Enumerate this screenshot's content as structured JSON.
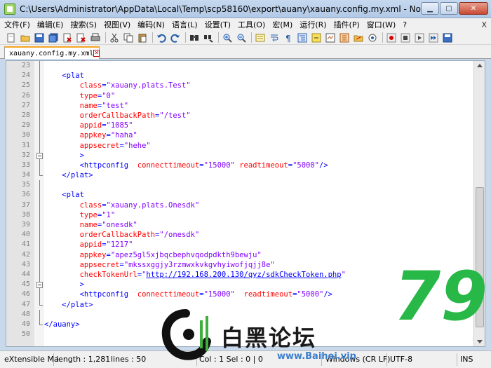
{
  "window": {
    "title": "C:\\Users\\Administrator\\AppData\\Local\\Temp\\scp58160\\export\\auany\\xauany.config.my.xml - Notepad++ [Administrat..."
  },
  "menu": [
    "文件(F)",
    "编辑(E)",
    "搜索(S)",
    "视图(V)",
    "编码(N)",
    "语言(L)",
    "设置(T)",
    "工具(O)",
    "宏(M)",
    "运行(R)",
    "插件(P)",
    "窗口(W)",
    "?"
  ],
  "menu_close": "X",
  "tab": {
    "label": "xauany.config.my.xml"
  },
  "editor": {
    "lines": [
      {
        "n": "23",
        "fold": "line",
        "parts": []
      },
      {
        "n": "24",
        "fold": "line",
        "parts": [
          [
            "sp",
            "    "
          ],
          [
            "tag",
            "<plat"
          ]
        ]
      },
      {
        "n": "25",
        "fold": "line",
        "parts": [
          [
            "sp",
            "        "
          ],
          [
            "attr",
            "class"
          ],
          [
            "tag",
            "="
          ],
          [
            "val",
            "\"xauany.plats.Test\""
          ]
        ]
      },
      {
        "n": "26",
        "fold": "line",
        "parts": [
          [
            "sp",
            "        "
          ],
          [
            "attr",
            "type"
          ],
          [
            "tag",
            "="
          ],
          [
            "val",
            "\"0\""
          ]
        ]
      },
      {
        "n": "27",
        "fold": "line",
        "parts": [
          [
            "sp",
            "        "
          ],
          [
            "attr",
            "name"
          ],
          [
            "tag",
            "="
          ],
          [
            "val",
            "\"test\""
          ]
        ]
      },
      {
        "n": "28",
        "fold": "line",
        "parts": [
          [
            "sp",
            "        "
          ],
          [
            "attr",
            "orderCallbackPath"
          ],
          [
            "tag",
            "="
          ],
          [
            "val",
            "\"/test\""
          ]
        ]
      },
      {
        "n": "29",
        "fold": "line",
        "parts": [
          [
            "sp",
            "        "
          ],
          [
            "attr",
            "appid"
          ],
          [
            "tag",
            "="
          ],
          [
            "val",
            "\"1085\""
          ]
        ]
      },
      {
        "n": "30",
        "fold": "line",
        "parts": [
          [
            "sp",
            "        "
          ],
          [
            "attr",
            "appkey"
          ],
          [
            "tag",
            "="
          ],
          [
            "val",
            "\"haha\""
          ]
        ]
      },
      {
        "n": "31",
        "fold": "line",
        "parts": [
          [
            "sp",
            "        "
          ],
          [
            "attr",
            "appsecret"
          ],
          [
            "tag",
            "="
          ],
          [
            "val",
            "\"hehe\""
          ]
        ]
      },
      {
        "n": "32",
        "fold": "box",
        "parts": [
          [
            "sp",
            "        "
          ],
          [
            "tag",
            ">"
          ]
        ]
      },
      {
        "n": "33",
        "fold": "line",
        "parts": [
          [
            "sp",
            "        "
          ],
          [
            "tag",
            "<httpconfig  "
          ],
          [
            "attr",
            "connecttimeout"
          ],
          [
            "tag",
            "="
          ],
          [
            "val",
            "\"15000\""
          ],
          [
            "sp",
            " "
          ],
          [
            "attr",
            "readtimeout"
          ],
          [
            "tag",
            "="
          ],
          [
            "val",
            "\"5000\""
          ],
          [
            "tag",
            "/>"
          ]
        ]
      },
      {
        "n": "34",
        "fold": "end",
        "parts": [
          [
            "sp",
            "    "
          ],
          [
            "tag",
            "</plat>"
          ]
        ]
      },
      {
        "n": "35",
        "fold": "line",
        "parts": []
      },
      {
        "n": "36",
        "fold": "line",
        "parts": [
          [
            "sp",
            "    "
          ],
          [
            "tag",
            "<plat"
          ]
        ]
      },
      {
        "n": "37",
        "fold": "line",
        "parts": [
          [
            "sp",
            "        "
          ],
          [
            "attr",
            "class"
          ],
          [
            "tag",
            "="
          ],
          [
            "val",
            "\"xauany.plats.Onesdk\""
          ]
        ]
      },
      {
        "n": "38",
        "fold": "line",
        "parts": [
          [
            "sp",
            "        "
          ],
          [
            "attr",
            "type"
          ],
          [
            "tag",
            "="
          ],
          [
            "val",
            "\"1\""
          ]
        ]
      },
      {
        "n": "39",
        "fold": "line",
        "parts": [
          [
            "sp",
            "        "
          ],
          [
            "attr",
            "name"
          ],
          [
            "tag",
            "="
          ],
          [
            "val",
            "\"onesdk\""
          ]
        ]
      },
      {
        "n": "40",
        "fold": "line",
        "parts": [
          [
            "sp",
            "        "
          ],
          [
            "attr",
            "orderCallbackPath"
          ],
          [
            "tag",
            "="
          ],
          [
            "val",
            "\"/onesdk\""
          ]
        ]
      },
      {
        "n": "41",
        "fold": "line",
        "parts": [
          [
            "sp",
            "        "
          ],
          [
            "attr",
            "appid"
          ],
          [
            "tag",
            "="
          ],
          [
            "val",
            "\"1217\""
          ]
        ]
      },
      {
        "n": "42",
        "fold": "line",
        "parts": [
          [
            "sp",
            "        "
          ],
          [
            "attr",
            "appkey"
          ],
          [
            "tag",
            "="
          ],
          [
            "val",
            "\"apez5gl5xjbqcbephvqodpdkth9bewju\""
          ]
        ]
      },
      {
        "n": "43",
        "fold": "line",
        "parts": [
          [
            "sp",
            "        "
          ],
          [
            "attr",
            "appsecret"
          ],
          [
            "tag",
            "="
          ],
          [
            "val",
            "\"mkssxggjy3rzmwxkvkgvhyiwofjqjj8e\""
          ]
        ]
      },
      {
        "n": "44",
        "fold": "line",
        "parts": [
          [
            "sp",
            "        "
          ],
          [
            "attr",
            "checkTokenUrl"
          ],
          [
            "tag",
            "="
          ],
          [
            "val",
            "\""
          ],
          [
            "link",
            "http://192.168.200.130/qyz/sdkCheckToken.php"
          ],
          [
            "val",
            "\""
          ]
        ]
      },
      {
        "n": "45",
        "fold": "box",
        "parts": [
          [
            "sp",
            "        "
          ],
          [
            "tag",
            ">"
          ]
        ]
      },
      {
        "n": "46",
        "fold": "line",
        "parts": [
          [
            "sp",
            "        "
          ],
          [
            "tag",
            "<httpconfig  "
          ],
          [
            "attr",
            "connecttimeout"
          ],
          [
            "tag",
            "="
          ],
          [
            "val",
            "\"15000\""
          ],
          [
            "sp",
            "  "
          ],
          [
            "attr",
            "readtimeout"
          ],
          [
            "tag",
            "="
          ],
          [
            "val",
            "\"5000\""
          ],
          [
            "tag",
            "/>"
          ]
        ]
      },
      {
        "n": "47",
        "fold": "end",
        "parts": [
          [
            "sp",
            "    "
          ],
          [
            "tag",
            "</plat>"
          ]
        ]
      },
      {
        "n": "48",
        "fold": "line",
        "parts": []
      },
      {
        "n": "49",
        "fold": "end",
        "parts": [
          [
            "tag",
            "</auany>"
          ]
        ]
      },
      {
        "n": "50",
        "fold": "none",
        "parts": []
      }
    ]
  },
  "status": {
    "filetype": "eXtensible Ma",
    "length": "length : 1,281",
    "lines": "lines : 50",
    "position": "Col : 1   Sel : 0 | 0",
    "eol": "Windows (CR LF)",
    "encoding": "UTF-8",
    "mode": "INS"
  },
  "watermark": {
    "text": "白黑论坛",
    "url": "www.Baihei.vip",
    "badge": "79"
  },
  "colors": {
    "tag": "#0000ff",
    "attr": "#ff0000",
    "value": "#8000ff"
  }
}
